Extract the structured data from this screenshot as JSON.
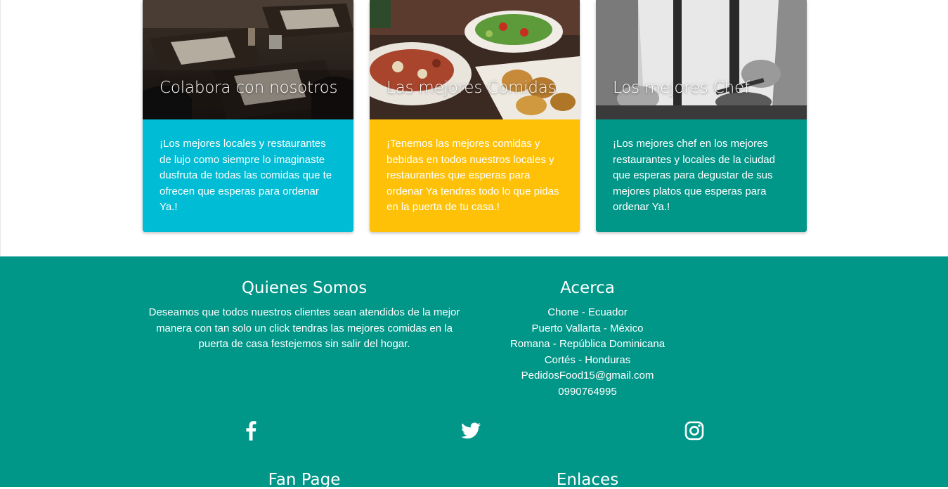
{
  "cards": [
    {
      "title": "Colabora con nosotros",
      "text": "¡Los mejores locales y restaurantes de lujo como siempre lo imaginaste dusfruta de todas las comidas que te ofrecen que esperas para ordenar Ya.!",
      "color": "#00bcd4"
    },
    {
      "title": "Las mejores Comidas",
      "text": "¡Tenemos las mejores comidas y bebidas en todos nuestros locales y restaurantes que esperas para ordenar Ya tendras todo lo que pidas en la puerta de tu casa.!",
      "color": "#ffc107"
    },
    {
      "title": "Los mejores Chef",
      "text": "¡Los mejores chef en los mejores restaurantes y locales de la ciudad que esperas para degustar de sus mejores platos que esperas para ordenar Ya.!",
      "color": "#009688"
    }
  ],
  "footer": {
    "background": "#009688",
    "about": {
      "title": "Quienes Somos",
      "text": "Deseamos que todos nuestros clientes sean atendidos de la mejor manera con tan solo un click tendras las mejores comidas en la puerta de casa festejemos sin salir del hogar."
    },
    "acerca": {
      "title": "Acerca",
      "items": [
        "Chone - Ecuador",
        "Puerto Vallarta - México",
        "Romana - República Dominicana",
        "Cortés - Honduras",
        "PedidosFood15@gmail.com",
        "0990764995"
      ]
    },
    "social": [
      "facebook-icon",
      "twitter-icon",
      "instagram-icon"
    ],
    "fan_page": {
      "title": "Fan Page"
    },
    "links": {
      "title": "Enlaces"
    }
  }
}
